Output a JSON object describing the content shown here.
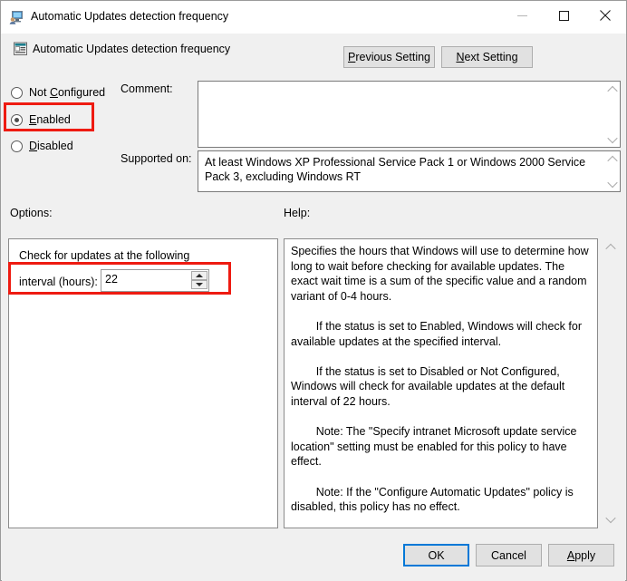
{
  "window": {
    "title": "Automatic Updates detection frequency",
    "title_icon": "computer-user-policy-icon",
    "minimize_label": "—",
    "maximize_label": "□",
    "close_label": "✕"
  },
  "header": {
    "icon": "policy-setting-icon",
    "title": "Automatic Updates detection frequency",
    "previous_setting": "Previous Setting",
    "previous_setting_accel": "P",
    "previous_setting_rest": "revious Setting",
    "next_setting": "Next Setting",
    "next_setting_accel": "N",
    "next_setting_rest": "ext Setting"
  },
  "state": {
    "options": [
      {
        "id": "not-configured",
        "label": "Not Configured",
        "accel_index": 4,
        "checked": false
      },
      {
        "id": "enabled",
        "label": "Enabled",
        "accel_index": 0,
        "checked": true
      },
      {
        "id": "disabled",
        "label": "Disabled",
        "accel_index": 0,
        "checked": false
      }
    ],
    "not_configured_pre": "Not ",
    "not_configured_accel": "C",
    "not_configured_post": "onfigured",
    "enabled_accel": "E",
    "enabled_post": "nabled",
    "disabled_accel": "D",
    "disabled_post": "isabled",
    "selected": "Enabled"
  },
  "comment": {
    "label": "Comment:",
    "value": "",
    "placeholder": ""
  },
  "supported_on": {
    "label": "Supported on:",
    "value": "At least Windows XP Professional Service Pack 1 or Windows 2000 Service Pack 3, excluding Windows RT"
  },
  "options_pane": {
    "label": "Options:",
    "group_label": "Check for updates at the following",
    "interval_label": "interval (hours):",
    "interval_value": "22",
    "spin_up": "spin-up-arrow",
    "spin_down": "spin-down-arrow"
  },
  "help_pane": {
    "label": "Help:",
    "text": "Specifies the hours that Windows will use to determine how long to wait before checking for available updates. The exact wait time is a sum of the specific value and a random variant of 0-4 hours.\n\n        If the status is set to Enabled, Windows will check for available updates at the specified interval.\n\n        If the status is set to Disabled or Not Configured, Windows will check for available updates at the default interval of 22 hours.\n\n        Note: The \"Specify intranet Microsoft update service location\" setting must be enabled for this policy to have effect.\n\n        Note: If the \"Configure Automatic Updates\" policy is disabled, this policy has no effect.\n\n        Note: This policy is not supported on Windows RT. Setting this policy will not have any effect on Windows RT PCs."
  },
  "footer": {
    "ok": "OK",
    "cancel": "Cancel",
    "apply": "Apply",
    "apply_accel": "A",
    "apply_rest": "pply"
  },
  "colors": {
    "highlight_red": "#ee1b11",
    "focus_blue": "#0078d7",
    "dialog_background": "#f0f0f0",
    "field_background": "#ffffff"
  }
}
